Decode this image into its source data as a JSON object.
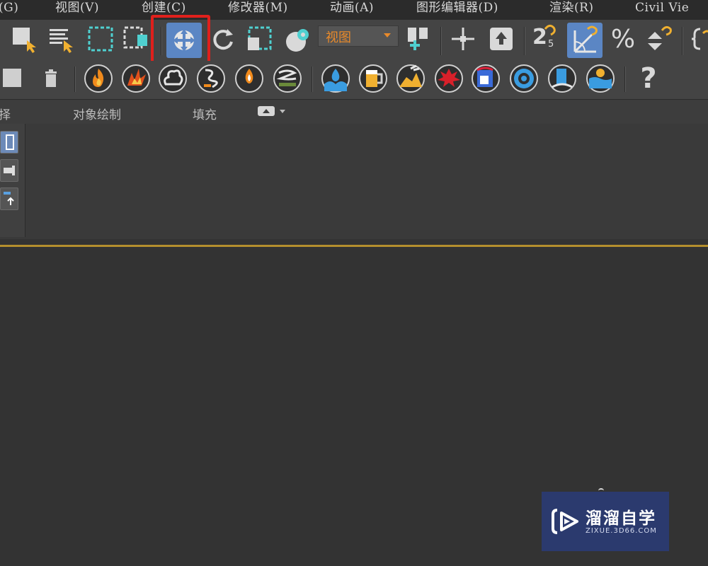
{
  "menu": {
    "items": [
      {
        "label": "(G)"
      },
      {
        "label": "视图(V)"
      },
      {
        "label": "创建(C)"
      },
      {
        "label": "修改器(M)"
      },
      {
        "label": "动画(A)"
      },
      {
        "label": "图形编辑器(D)"
      },
      {
        "label": "渲染(R)"
      },
      {
        "label": "Civil Vie"
      }
    ]
  },
  "toolbar": {
    "reference_coord_dropdown": {
      "value": "视图"
    },
    "snap_toggle_label": "2",
    "snap_toggle_sub": "5",
    "percent_snap_label": "%",
    "help_label": "?",
    "selected_tool": "select-and-move",
    "highlight_color": "#e0201c",
    "accent_color": "#5b86c4",
    "dropdown_text_color": "#e98a2a"
  },
  "toolbar2": {
    "icons": [
      "fire-icon",
      "explosion-icon",
      "smoke-icon",
      "wisp-icon",
      "candle-icon",
      "steam-icon",
      "water-splash-icon",
      "beer-icon",
      "lava-icon",
      "blood-splat-icon",
      "paint-bucket-icon",
      "whirlpool-icon",
      "waterfall-icon",
      "ocean-icon"
    ]
  },
  "ribbon": {
    "tabs": [
      {
        "label": "择"
      },
      {
        "label": "对象绘制"
      },
      {
        "label": "填充"
      }
    ]
  },
  "watermark": {
    "title": "溜溜自学",
    "url": "ZIXUE.3D66.COM",
    "bg_color": "#2b3a6e"
  }
}
